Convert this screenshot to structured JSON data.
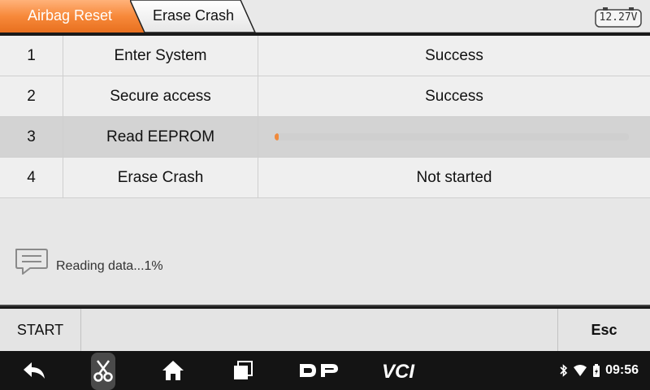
{
  "header": {
    "crumbs": [
      "Airbag Reset",
      "Erase Crash"
    ],
    "voltage": "12.27V"
  },
  "steps": [
    {
      "num": "1",
      "name": "Enter System",
      "status": "Success"
    },
    {
      "num": "2",
      "name": "Secure access",
      "status": "Success"
    },
    {
      "num": "3",
      "name": "Read EEPROM",
      "status": "",
      "progress_percent": 1
    },
    {
      "num": "4",
      "name": "Erase Crash",
      "status": "Not started"
    }
  ],
  "message": {
    "text": "Reading data...1%",
    "icon": "message-icon"
  },
  "actions": {
    "start_label": "START",
    "esc_label": "Esc"
  },
  "navbar": {
    "dp_label": "DP",
    "vci_label": "VCI",
    "time": "09:56",
    "icons": [
      "back-icon",
      "scissors-icon",
      "home-icon",
      "recent-apps-icon",
      "bluetooth-icon",
      "wifi-icon",
      "battery-icon"
    ]
  },
  "colors": {
    "accent": "#f08a3c",
    "active_row": "#d3d3d3"
  }
}
